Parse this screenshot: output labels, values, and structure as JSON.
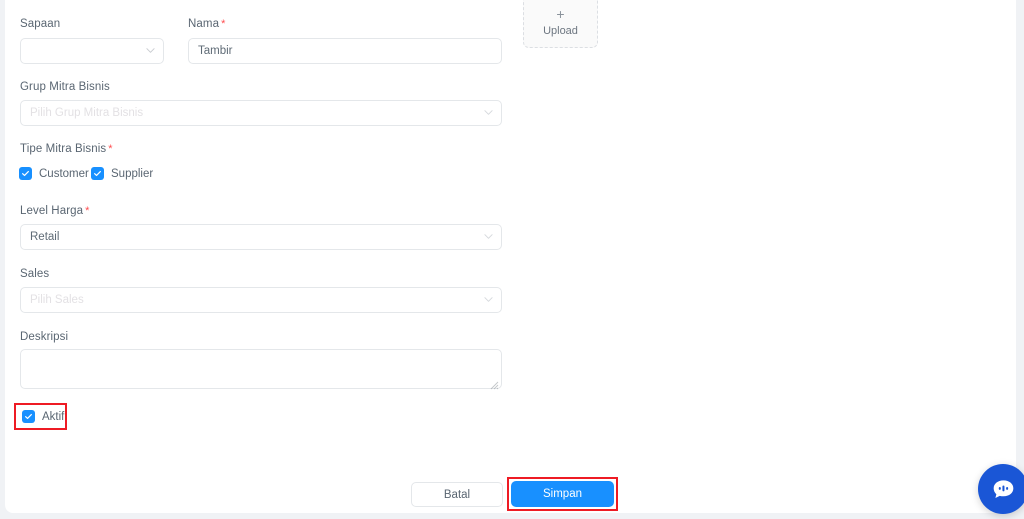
{
  "form": {
    "fields": {
      "sapaan": {
        "label": "Sapaan",
        "value": "",
        "placeholder": ""
      },
      "nama": {
        "label": "Nama",
        "required_mark": "*",
        "value": "Tambir"
      },
      "grup_mitra_bisnis": {
        "label": "Grup Mitra Bisnis",
        "value": "",
        "placeholder": "Pilih Grup Mitra Bisnis"
      },
      "tipe_mitra_bisnis": {
        "label": "Tipe Mitra Bisnis",
        "required_mark": "*"
      },
      "level_harga": {
        "label": "Level Harga",
        "required_mark": "*",
        "value": "Retail"
      },
      "sales": {
        "label": "Sales",
        "value": "",
        "placeholder": "Pilih Sales"
      },
      "deskripsi": {
        "label": "Deskripsi",
        "value": ""
      }
    },
    "checkboxes": {
      "customer": {
        "label": "Customer",
        "checked": true
      },
      "supplier": {
        "label": "Supplier",
        "checked": true
      },
      "aktif": {
        "label": "Aktif",
        "checked": true
      }
    },
    "upload": {
      "plus_glyph": "+",
      "label": "Upload"
    },
    "actions": {
      "cancel": "Batal",
      "submit": "Simpan"
    }
  },
  "annotations": {
    "highlight_color": "#ee1b24",
    "targets": [
      "aktif-checkbox",
      "simpan-button"
    ]
  },
  "chat_widget": {
    "icon": "chat-bubble-icon"
  },
  "colors": {
    "primary": "#1890ff",
    "required_asterisk": "#ff4d4f",
    "label_text": "#5a6672",
    "border": "#e4e7ea",
    "page_background": "#f0f2f5",
    "card_background": "#ffffff",
    "chat_button": "#1a56d6"
  }
}
